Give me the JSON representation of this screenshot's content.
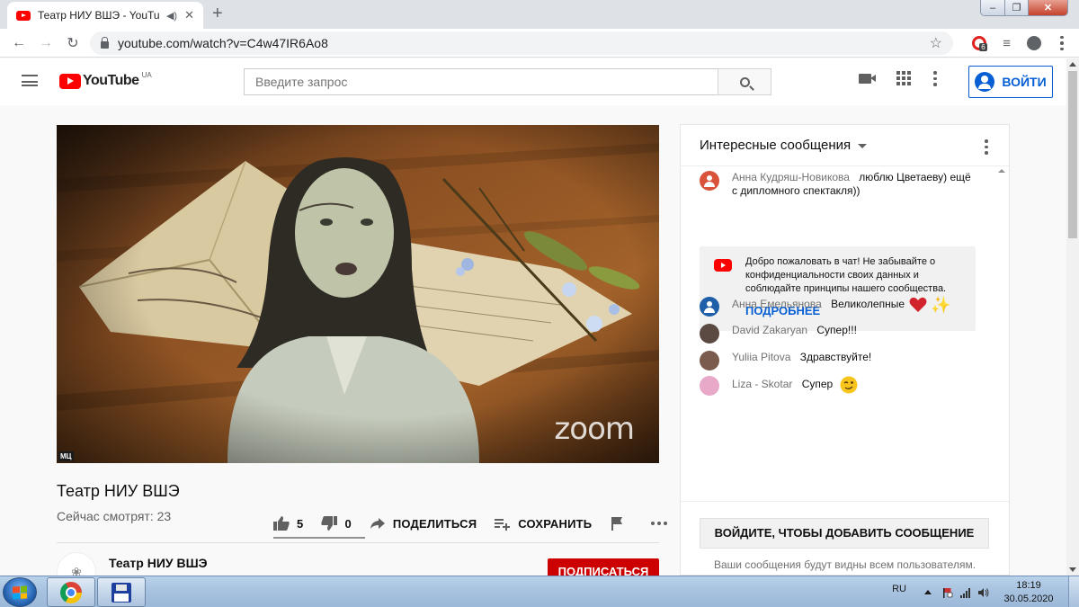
{
  "browser": {
    "tab_title": "Театр НИУ ВШЭ - YouTube",
    "tab_close": "✕",
    "new_tab": "+",
    "url": "youtube.com/watch?v=C4w47IR6Ao8",
    "extension_badge": "6"
  },
  "header": {
    "logo_text": "YouTube",
    "logo_region": "UA",
    "search_placeholder": "Введите запрос",
    "signin_label": "ВОЙТИ"
  },
  "video": {
    "watermark": "zoom",
    "corner_badge": "МЦ",
    "title": "Театр НИУ ВШЭ",
    "viewers": "Сейчас смотрят: 23",
    "likes": "5",
    "dislikes": "0",
    "share_label": "ПОДЕЛИТЬСЯ",
    "save_label": "СОХРАНИТЬ"
  },
  "channel": {
    "name": "Театр НИУ ВШЭ",
    "subscribe_label": "ПОДПИСАТЬСЯ"
  },
  "chat": {
    "header": "Интересные сообщения",
    "messages": [
      {
        "author": "Анна Кудряш-Новикова",
        "text": "люблю Цветаеву) ещё",
        "text2": "с дипломного спектакля))",
        "avatar_color": "#d9533a"
      },
      {
        "author": "Анна Емельянова",
        "text": "Великолепные",
        "avatar_color": "#1f5ea8"
      },
      {
        "author": "David Zakaryan",
        "text": "Супер!!!",
        "avatar_color": "#5a4a42"
      },
      {
        "author": "Yuliia Pitova",
        "text": "Здравствуйте!",
        "avatar_color": "#7a5b4d"
      },
      {
        "author": "Liza - Skotar",
        "text": "Супер",
        "avatar_color": "#e8a9c8"
      }
    ],
    "welcome_text": "Добро пожаловать в чат! Не забывайте о конфиденциальности своих данных и соблюдайте принципы нашего сообщества.",
    "welcome_link": "ПОДРОБНЕЕ",
    "signin_button": "ВОЙДИТЕ, ЧТОБЫ ДОБАВИТЬ СООБЩЕНИЕ",
    "footer_note": "Ваши сообщения будут видны всем пользователям."
  },
  "taskbar": {
    "language": "RU",
    "time": "18:19",
    "date": "30.05.2020"
  }
}
